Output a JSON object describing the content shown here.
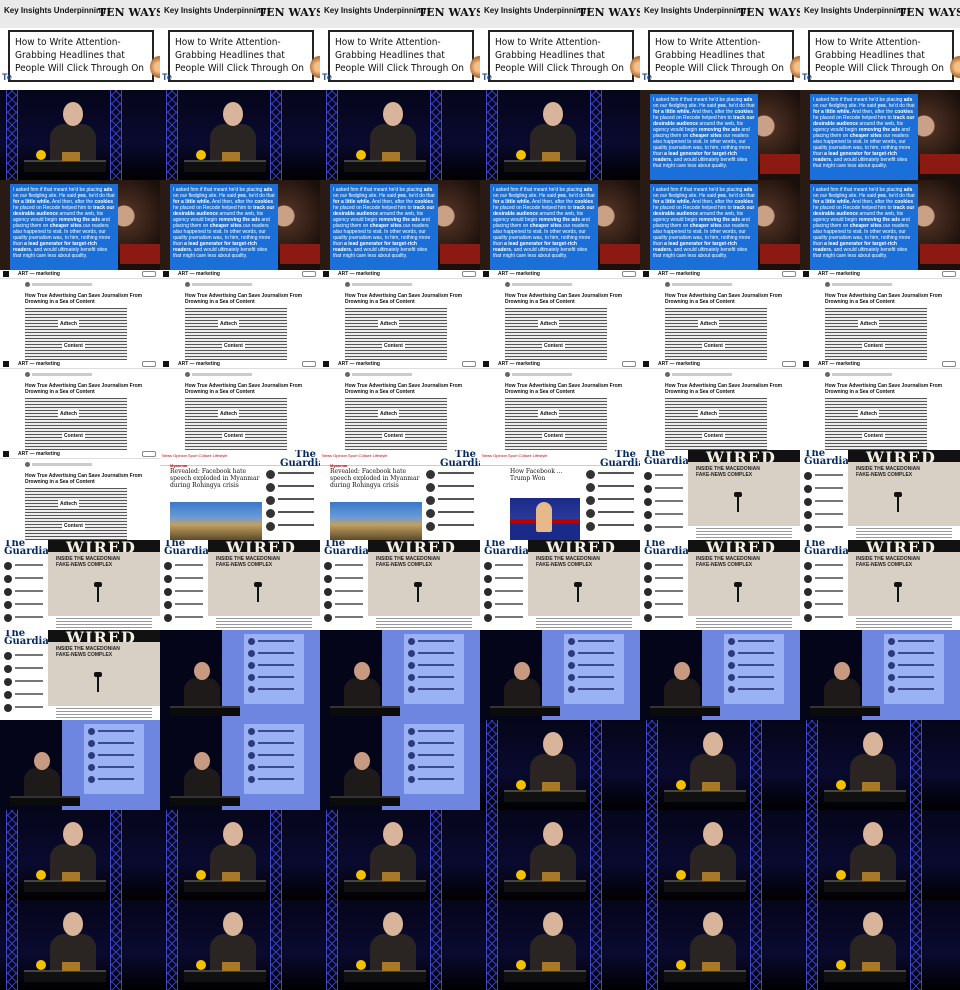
{
  "headline_slide": {
    "top_left_text": "Key Insights Underpinning t",
    "top_right_text": "TEN WAYS TO",
    "card_text": "How to Write Attention-Grabbing Headlines that People Will Click Through On",
    "corner_text": "Te"
  },
  "quote_slide": {
    "segments": [
      {
        "t": "I asked him if that meant he'd be placing ",
        "b": false
      },
      {
        "t": "ads",
        "b": true
      },
      {
        "t": " on our fledgling site. He said ",
        "b": false
      },
      {
        "t": "yes",
        "b": true
      },
      {
        "t": ", he'd do that ",
        "b": false
      },
      {
        "t": "for a little while.",
        "b": true
      },
      {
        "t": " And then, after the ",
        "b": false
      },
      {
        "t": "cookies",
        "b": true
      },
      {
        "t": " he placed on Recode helped him to ",
        "b": false
      },
      {
        "t": "track our desirable audience",
        "b": true
      },
      {
        "t": " around the web, his agency would begin ",
        "b": false
      },
      {
        "t": "removing the ads",
        "b": true
      },
      {
        "t": " and placing them on ",
        "b": false
      },
      {
        "t": "cheaper sites",
        "b": true
      },
      {
        "t": " our readers also happened to visit. In other words, our quality journalism was, to him, nothing more than ",
        "b": false
      },
      {
        "t": "a lead generator for target-rich readers",
        "b": true
      },
      {
        "t": ", and would ultimately benefit sites that might care less about quality.",
        "b": false
      }
    ]
  },
  "article_slide": {
    "publication": "ART — marketing",
    "title": "How True Advertising Can Save Journalism From Drowning in a Sea of Content",
    "image_word_1": "Adtech",
    "image_word_2": "Content"
  },
  "guardian_slide": {
    "nav_text": "News  Opinion  Sport  Culture  Lifestyle",
    "logo_line_1": "The",
    "logo_line_2": "Guardian",
    "kicker": "Myanmar",
    "headline": "Revealed: Facebook hate speech exploded in Myanmar during Rohingya crisis"
  },
  "trump_slide": {
    "headline": "How Facebook ... Trump Won"
  },
  "macedonia_slide": {
    "logo_line_1": "The",
    "logo_line_2": "Guardian",
    "masthead": "WIRED",
    "title_line_1": "INSIDE THE MACEDONIAN",
    "title_line_2": "FAKE-NEWS COMPLEX"
  },
  "grid": {
    "columns": 6,
    "rows": 11,
    "cells": [
      "headline",
      "headline",
      "headline",
      "headline",
      "headline",
      "headline",
      "stage",
      "stage",
      "stage",
      "stage",
      "quote",
      "quote",
      "quote",
      "quote",
      "quote",
      "quote",
      "quote",
      "quote",
      "article",
      "article",
      "article",
      "article",
      "article",
      "article",
      "article",
      "article",
      "article",
      "article",
      "article",
      "article",
      "article",
      "guardian",
      "guardian",
      "trump",
      "macedonia",
      "macedonia",
      "macedonia",
      "macedonia",
      "macedonia",
      "macedonia",
      "macedonia",
      "macedonia",
      "macedonia",
      "proj",
      "proj",
      "proj",
      "proj",
      "proj",
      "proj",
      "proj",
      "proj",
      "stage",
      "stage",
      "stage",
      "stage",
      "stage",
      "stage",
      "stage",
      "stage",
      "stage",
      "stage",
      "stage",
      "stage",
      "stage",
      "stage",
      "stage"
    ]
  }
}
